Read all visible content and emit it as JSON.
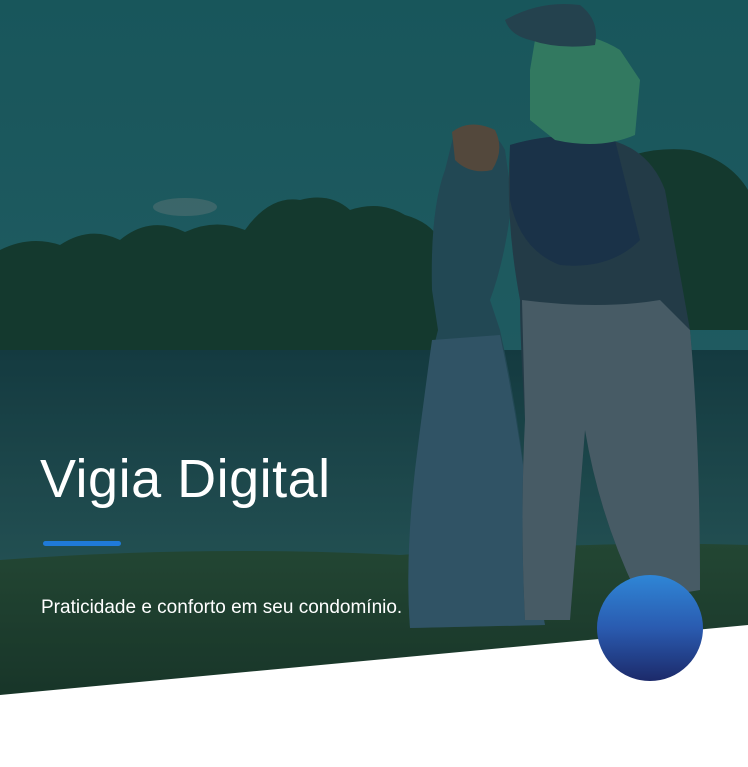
{
  "hero": {
    "title": "Vigia Digital",
    "subtitle": "Praticidade e conforto em seu condomínio."
  },
  "colors": {
    "accent": "#1f7ad8",
    "circle_top": "#2f86d6",
    "circle_bottom": "#1c2a6a",
    "overlay": "#0d3a44"
  }
}
